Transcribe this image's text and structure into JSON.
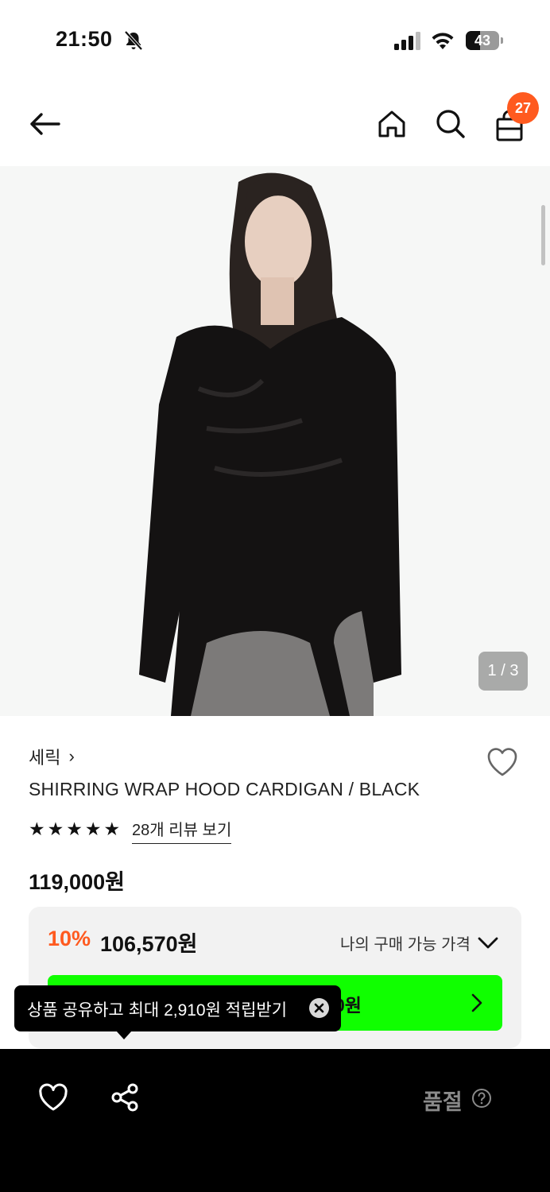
{
  "status_bar": {
    "time": "21:50",
    "battery": "43",
    "battery_level": 0.43
  },
  "header": {
    "back_icon": "arrow-left-icon",
    "home_icon": "home-icon",
    "search_icon": "search-icon",
    "cart_icon": "shopping-bag-icon",
    "cart_badge": "27"
  },
  "gallery": {
    "counter": "1 / 3"
  },
  "product": {
    "brand": "세릭",
    "brand_chevron": "›",
    "title": "SHIRRING WRAP HOOD CARDIGAN / BLACK",
    "rating": 5,
    "review_link": "28개 리뷰 보기",
    "original_price": "119,000원"
  },
  "price_box": {
    "discount_percent": "10%",
    "discount_price": "106,570원",
    "my_price_label": "나의 구매 가능 가격",
    "green_button_visible_text": "0원"
  },
  "tooltip": {
    "text": "상품 공유하고 최대 2,910원 적립받기"
  },
  "bottom_bar": {
    "status": "품절",
    "help_icon": "question-circle-icon"
  },
  "colors": {
    "accent_orange": "#ff5a1f",
    "cta_green": "#10ff00"
  }
}
